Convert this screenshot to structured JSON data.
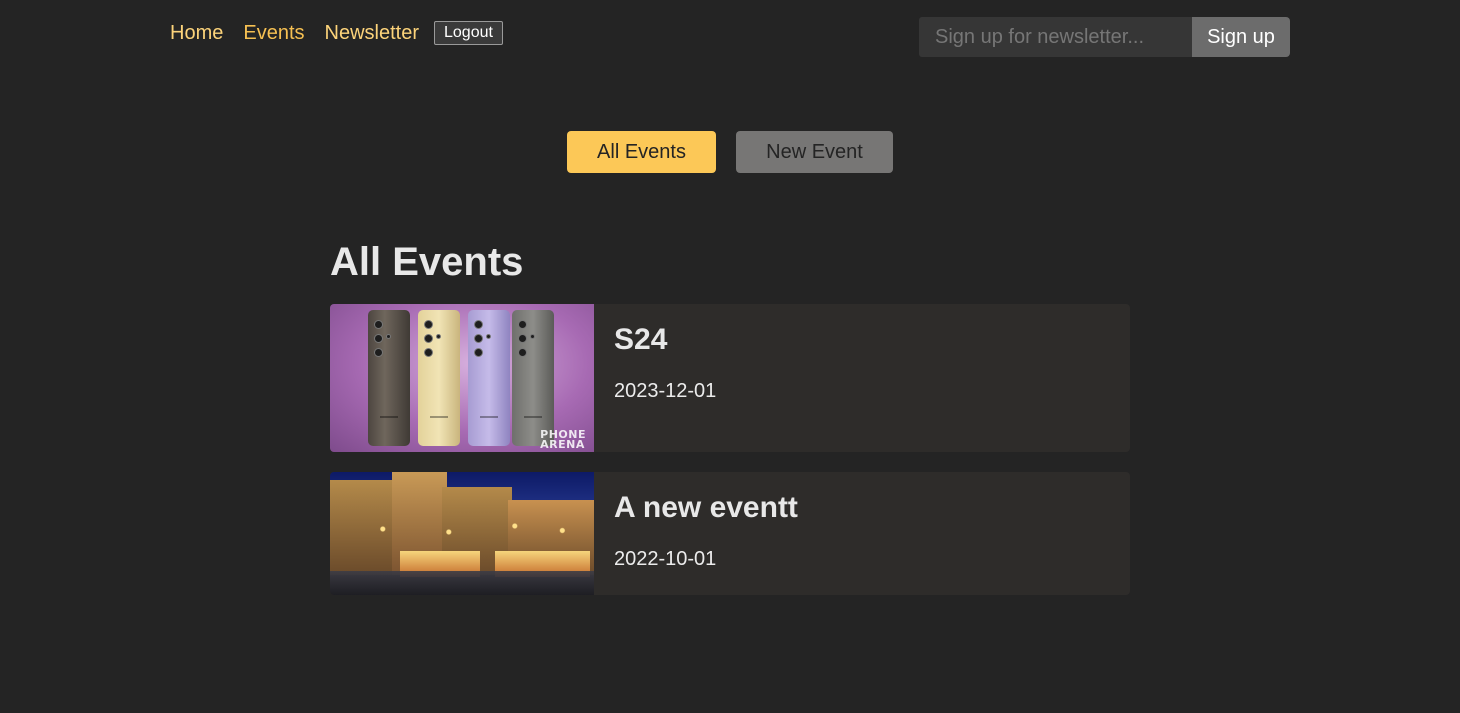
{
  "header": {
    "nav": [
      {
        "label": "Home",
        "active": false
      },
      {
        "label": "Events",
        "active": true
      },
      {
        "label": "Newsletter",
        "active": false
      }
    ],
    "logout_label": "Logout",
    "newsletter": {
      "placeholder": "Sign up for newsletter...",
      "value": "",
      "button_label": "Sign up"
    }
  },
  "events_nav": {
    "all_label": "All Events",
    "new_label": "New Event",
    "active": "All Events"
  },
  "main": {
    "title": "All Events",
    "events": [
      {
        "title": "S24",
        "date": "2023-12-01",
        "image": "smartphones-photo",
        "watermark": "PHONE ARENA"
      },
      {
        "title": "A new eventt",
        "date": "2022-10-01",
        "image": "christmas-market-photo"
      }
    ]
  },
  "colors": {
    "background": "#242424",
    "accent": "#fcc857",
    "nav_link": "#fcd37a",
    "card": "#2e2c2a"
  }
}
